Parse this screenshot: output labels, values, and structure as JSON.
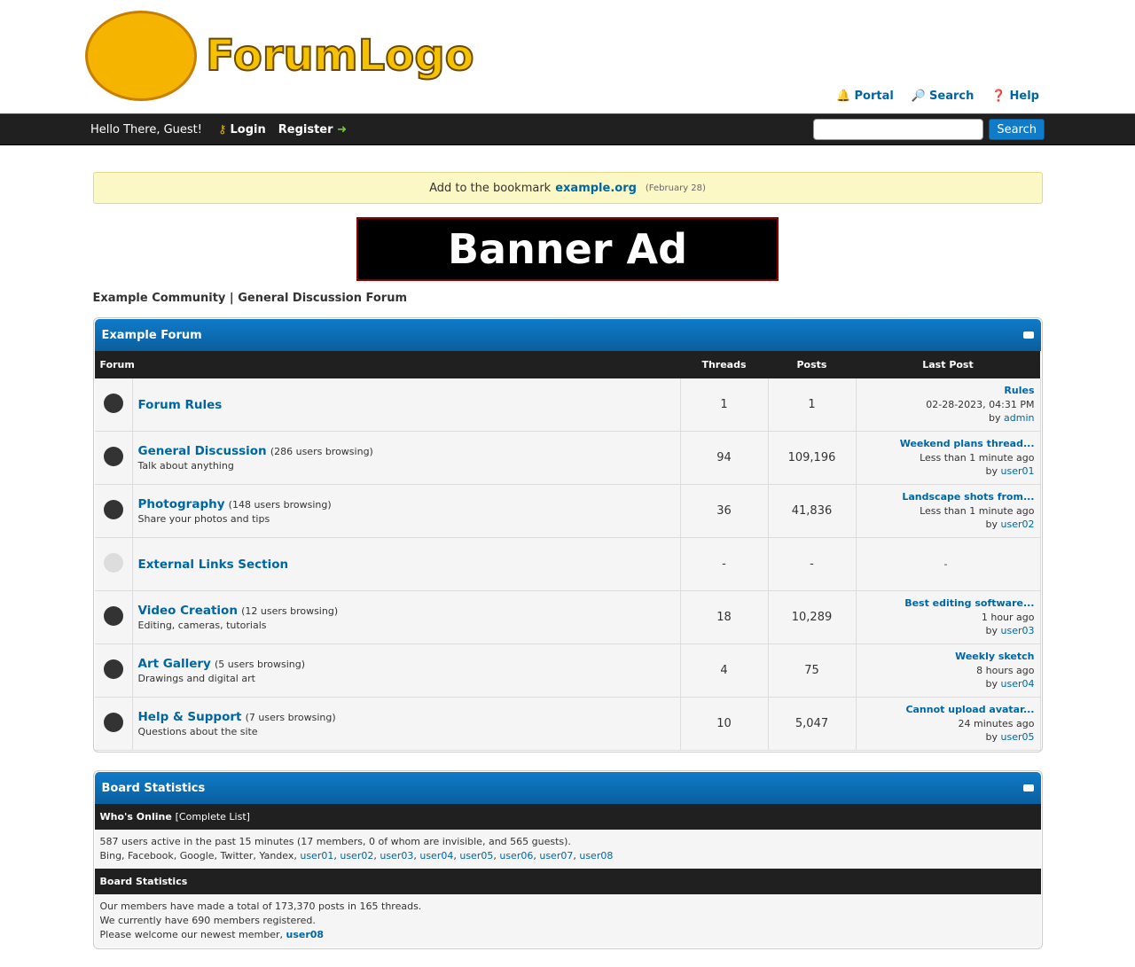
{
  "header": {
    "logo_text": "ForumLogo",
    "links": [
      {
        "icon": "bell-icon",
        "label": "Portal"
      },
      {
        "icon": "search-icon",
        "label": "Search"
      },
      {
        "icon": "help-icon",
        "label": "Help"
      }
    ]
  },
  "navbar": {
    "greeting": "Hello There, Guest!",
    "login": "Login",
    "register": "Register",
    "search_button": "Search",
    "search_placeholder": ""
  },
  "notice": {
    "text": "Add to the bookmark",
    "link": "example.org",
    "date": "(February 28)"
  },
  "banner": {
    "text": "Banner Ad"
  },
  "tagline": "Example Community | General Discussion Forum",
  "forum": {
    "title": "Example Forum",
    "columns": [
      "Forum",
      "Threads",
      "Posts",
      "Last Post"
    ],
    "rows": [
      {
        "name": "Forum Rules",
        "browsing": "",
        "desc": "",
        "threads": "1",
        "posts": "1",
        "lp_title": "Rules",
        "lp_time": "02-28-2023, 04:31 PM",
        "lp_by": "by",
        "lp_user": "admin",
        "unread": true
      },
      {
        "name": "General Discussion",
        "browsing": "(286 users browsing)",
        "desc": "Talk about anything",
        "threads": "94",
        "posts": "109,196",
        "lp_title": "Weekend plans thread...",
        "lp_time": "Less than 1 minute ago",
        "lp_by": "by",
        "lp_user": "user01",
        "unread": true
      },
      {
        "name": "Photography",
        "browsing": "(148 users browsing)",
        "desc": "Share your photos and tips",
        "threads": "36",
        "posts": "41,836",
        "lp_title": "Landscape shots from...",
        "lp_time": "Less than 1 minute ago",
        "lp_by": "by",
        "lp_user": "user02",
        "unread": true
      },
      {
        "name": "External Links Section",
        "browsing": "",
        "desc": "",
        "threads": "-",
        "posts": "-",
        "lp_title": "",
        "lp_time": "-",
        "lp_by": "",
        "lp_user": "",
        "unread": false
      },
      {
        "name": "Video Creation",
        "browsing": "(12 users browsing)",
        "desc": "Editing, cameras, tutorials",
        "threads": "18",
        "posts": "10,289",
        "lp_title": "Best editing software...",
        "lp_time": "1 hour ago",
        "lp_by": "by",
        "lp_user": "user03",
        "unread": true
      },
      {
        "name": "Art Gallery",
        "browsing": "(5 users browsing)",
        "desc": "Drawings and digital art",
        "threads": "4",
        "posts": "75",
        "lp_title": "Weekly sketch",
        "lp_time": "8 hours ago",
        "lp_by": "by",
        "lp_user": "user04",
        "unread": true
      },
      {
        "name": "Help & Support",
        "browsing": "(7 users browsing)",
        "desc": "Questions about the site",
        "threads": "10",
        "posts": "5,047",
        "lp_title": "Cannot upload avatar...",
        "lp_time": "24 minutes ago",
        "lp_by": "by",
        "lp_user": "user05",
        "unread": true
      }
    ]
  },
  "stats": {
    "title": "Board Statistics",
    "online_label": "Who's Online",
    "online_link": "[Complete List]",
    "online_text": "587 users active in the past 15 minutes (17 members, 0 of whom are invisible, and 565 guests).",
    "bots": "Bing, Facebook, Google, Twitter, Yandex,",
    "members": [
      "user01",
      "user02",
      "user03",
      "user04",
      "user05",
      "user06",
      "user07",
      "user08"
    ],
    "sub_title": "Board Statistics",
    "line1": "Our members have made a total of 173,370 posts in 165 threads.",
    "line2": "We currently have 690 members registered.",
    "line3": "Please welcome our newest member,",
    "newest": "user08"
  }
}
